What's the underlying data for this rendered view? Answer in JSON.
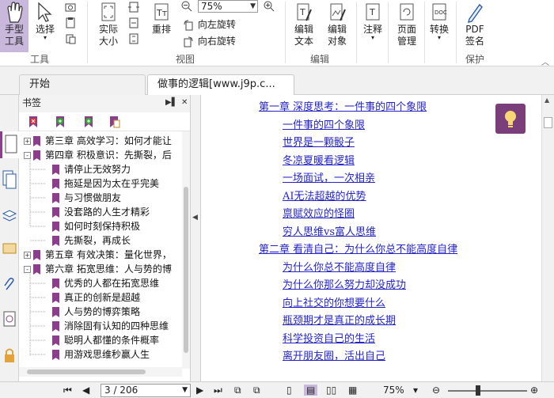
{
  "ribbon": {
    "hand_tool": "手型\n工具",
    "select": "选择",
    "actual_size": "实际\n大小",
    "reflow": "重排",
    "zoom_value": "75%",
    "rotate_left": "向左旋转",
    "rotate_right": "向右旋转",
    "edit_text": "编辑\n文本",
    "edit_object": "编辑\n对象",
    "comment": "注释",
    "page_manage": "页面\n管理",
    "convert": "转换",
    "pdf_sign": "PDF\n签名",
    "group_tools": "工具",
    "group_view": "视图",
    "group_edit": "编辑",
    "group_protect": "保护"
  },
  "tabs": [
    {
      "label": "开始"
    },
    {
      "label": "做事的逻辑[www.j9p.c..."
    }
  ],
  "bookmarks": {
    "title": "书签",
    "items": [
      {
        "label": "第三章 高效学习：如何才能让",
        "level": 0,
        "toggle": "+"
      },
      {
        "label": "第四章 积极意识：先撕裂，后",
        "level": 0,
        "toggle": "-"
      },
      {
        "label": "请停止无效努力",
        "level": 1
      },
      {
        "label": "拖延是因为太在乎完美",
        "level": 1
      },
      {
        "label": "与习惯做朋友",
        "level": 1
      },
      {
        "label": "没套路的人生才精彩",
        "level": 1
      },
      {
        "label": "如何时刻保持积极",
        "level": 1
      },
      {
        "label": "先撕裂，再成长",
        "level": 1
      },
      {
        "label": "第五章 有效决策：量化世界，",
        "level": 0,
        "toggle": "+"
      },
      {
        "label": "第六章 拓宽思维：人与势的博",
        "level": 0,
        "toggle": "-"
      },
      {
        "label": "优秀的人都在拓宽思维",
        "level": 1
      },
      {
        "label": "真正的创新是超越",
        "level": 1
      },
      {
        "label": "人与势的博弈策略",
        "level": 1
      },
      {
        "label": "消除固有认知的四种思维",
        "level": 1
      },
      {
        "label": "聪明人都懂的条件概率",
        "level": 1
      },
      {
        "label": "用游戏思维秒赢人生",
        "level": 1
      }
    ]
  },
  "document": {
    "toc": [
      {
        "text": "第一章 深度思考：一件事的四个象限",
        "level": 0
      },
      {
        "text": "一件事的四个象限",
        "level": 1
      },
      {
        "text": "世界是一颗骰子",
        "level": 1
      },
      {
        "text": "冬凉夏暖看逻辑",
        "level": 1
      },
      {
        "text": "一场面试，一次相亲",
        "level": 1
      },
      {
        "text": "AI无法超越的优势",
        "level": 1
      },
      {
        "text": "禀赋效应的怪圈",
        "level": 1
      },
      {
        "text": "穷人思维vs富人思维",
        "level": 1
      },
      {
        "text": "第二章 看清自己：为什么你总不能高度自律",
        "level": 0
      },
      {
        "text": "为什么你总不能高度自律",
        "level": 1
      },
      {
        "text": "为什么你那么努力却没成功",
        "level": 1
      },
      {
        "text": "向上社交的你想要什么",
        "level": 1
      },
      {
        "text": "瓶颈期才是真正的成长期",
        "level": 1
      },
      {
        "text": "科学投资自己的生活",
        "level": 1
      },
      {
        "text": "离开朋友圈，活出自己",
        "level": 1
      }
    ]
  },
  "statusbar": {
    "page": "3 / 206",
    "zoom": "75%"
  },
  "colors": {
    "accent_purple": "#8c3d8c",
    "link_blue": "#2424c8",
    "hand_tool_bg": "#c9b7dc"
  }
}
